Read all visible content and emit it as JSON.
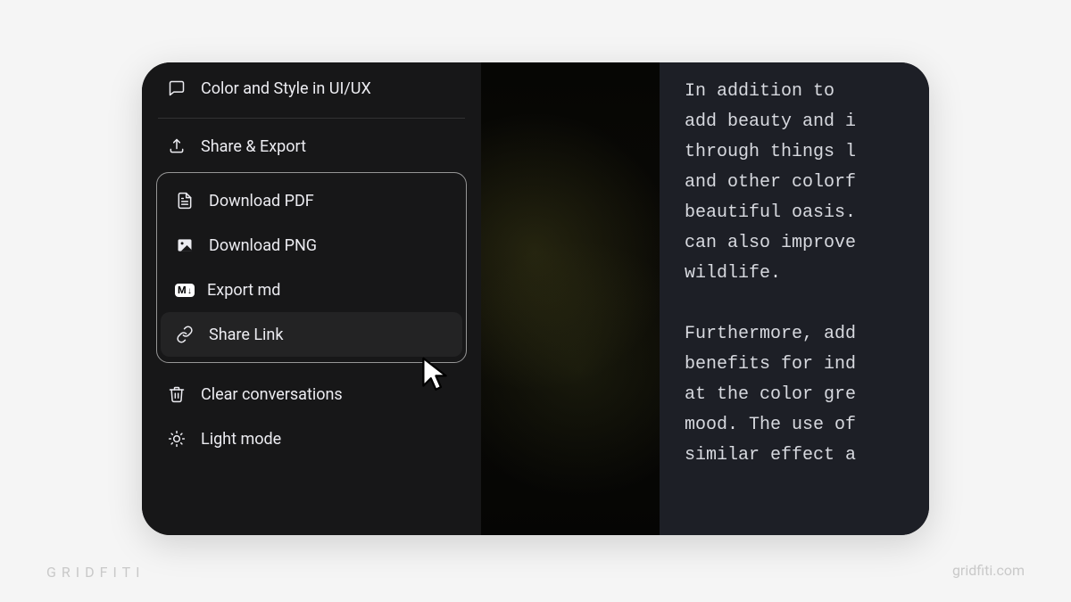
{
  "sidebar": {
    "conversation_title": "Color and Style in UI/UX",
    "share_export_label": "Share & Export",
    "export_items": [
      {
        "label": "Download PDF"
      },
      {
        "label": "Download PNG"
      },
      {
        "label": "Export md"
      },
      {
        "label": "Share Link"
      }
    ],
    "md_badge_text": "M↓",
    "clear_label": "Clear conversations",
    "light_mode_label": "Light mode"
  },
  "content": {
    "text": "In addition to \nadd beauty and i\nthrough things l\nand other colorf\nbeautiful oasis.\ncan also improve\nwildlife.\n\nFurthermore, add\nbenefits for ind\nat the color gre\nmood. The use of\nsimilar effect a"
  },
  "branding": {
    "left": "GRIDFITI",
    "right": "gridfiti.com"
  }
}
